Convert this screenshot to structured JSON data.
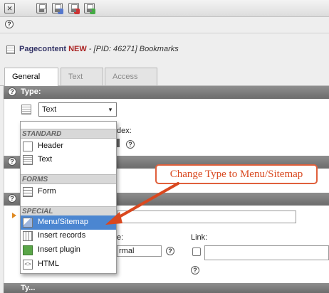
{
  "toolbar": {
    "close_glyph": "×",
    "buttons": [
      "close",
      "save",
      "save-and-view",
      "save-and-close",
      "save-and-new"
    ],
    "help_glyph": "?"
  },
  "record": {
    "table": "Pagecontent",
    "status": "NEW",
    "pid_text": " - [PID: 46271] Bookmarks"
  },
  "tabs": [
    {
      "label": "General",
      "active": true
    },
    {
      "label": "Text",
      "active": false
    },
    {
      "label": "Access",
      "active": false
    }
  ],
  "type_section": {
    "heading": "Type:",
    "selected": "Text",
    "arrow_glyph": "▾"
  },
  "dropdown": {
    "groups": [
      {
        "label": "STANDARD",
        "options": [
          "Header",
          "Text"
        ]
      },
      {
        "label": "FORMS",
        "options": [
          "Form"
        ]
      },
      {
        "label": "SPECIAL",
        "options": [
          "Menu/Sitemap",
          "Insert records",
          "Insert plugin",
          "HTML"
        ]
      }
    ],
    "highlighted": "Menu/Sitemap"
  },
  "background_fields": {
    "index_label_fragment": "dex:",
    "layout_label_fragment": "e:",
    "layout_value_fragment": "rmal",
    "link_label": "Link:",
    "next_heading_fragment": "Ty..."
  },
  "annotation": {
    "text": "Change Type to Menu/Sitemap",
    "color": "#e0603c"
  },
  "colors": {
    "selection": "#4b86d1",
    "section_header": "#7c7c7c",
    "status_new": "#aa2222"
  }
}
